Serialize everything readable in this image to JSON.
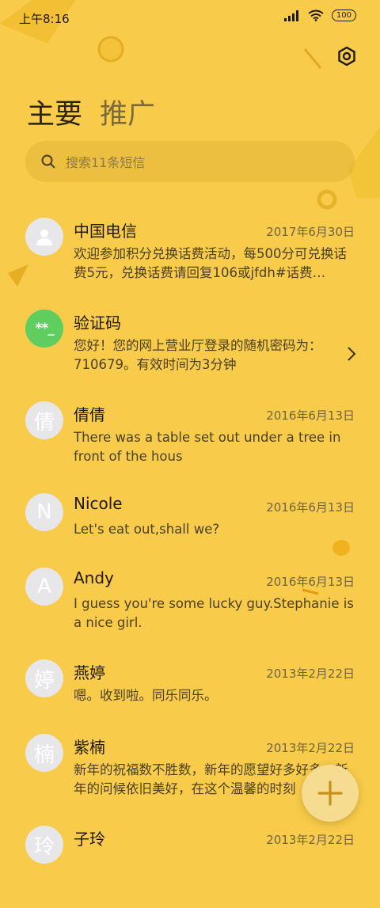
{
  "status": {
    "time": "上午8:16",
    "battery": "100"
  },
  "tabs": {
    "primary": "主要",
    "promo": "推广"
  },
  "search": {
    "placeholder": "搜索11条短信"
  },
  "messages": [
    {
      "name": "中国电信",
      "date": "2017年6月30日",
      "preview": "欢迎参加积分兑换话费活动，每500分可兑换话费5元，兑换话费请回复106或jfdh#话费…",
      "avatar": "person-icon"
    },
    {
      "name": "验证码",
      "date": "",
      "preview": "您好！您的网上营业厅登录的随机密码为：710679。有效时间为3分钟",
      "avatar_text": "**_"
    },
    {
      "name": "倩倩",
      "date": "2016年6月13日",
      "preview": "There was a table set out under a tree in front of the hous",
      "avatar_text": "倩"
    },
    {
      "name": "Nicole",
      "date": "2016年6月13日",
      "preview": "Let's eat out,shall we?",
      "avatar_text": "N"
    },
    {
      "name": "Andy",
      "date": "2016年6月13日",
      "preview": "I guess you're some lucky guy.Stephanie is a nice girl.",
      "avatar_text": "A"
    },
    {
      "name": "燕婷",
      "date": "2013年2月22日",
      "preview": "嗯。收到啦。同乐同乐。",
      "avatar_text": "婷"
    },
    {
      "name": "紫楠",
      "date": "2013年2月22日",
      "preview": "新年的祝福数不胜数，新年的愿望好多好多，新年的问候依旧美好，在这个温馨的时刻",
      "avatar_text": "楠"
    },
    {
      "name": "子玲",
      "date": "2013年2月22日",
      "preview": "",
      "avatar_text": "玲"
    }
  ],
  "colors": {
    "background": "#f8cb4a",
    "verify_avatar": "#5fce5f",
    "fab": "#f6dc90"
  }
}
